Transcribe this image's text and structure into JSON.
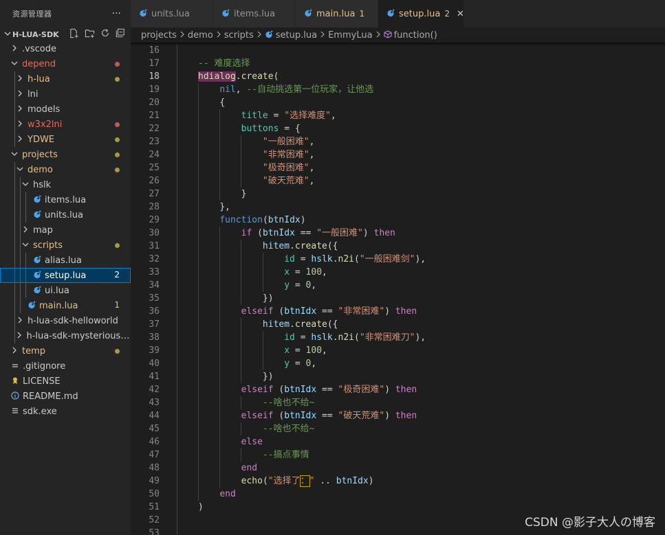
{
  "sidebar": {
    "title": "资源管理器",
    "more": "···",
    "project": "H-LUA-SDK",
    "items": [
      {
        "label": ".vscode",
        "depth": 0,
        "chev": ">",
        "color": "#cccccc"
      },
      {
        "label": "depend",
        "depth": 0,
        "chev": "v",
        "color": "#e06c60",
        "dot": "#c45a55"
      },
      {
        "label": "h-lua",
        "depth": 1,
        "chev": ">",
        "color": "#e2c08d",
        "dot": "#a89a43"
      },
      {
        "label": "lni",
        "depth": 1,
        "chev": ">",
        "color": "#cccccc"
      },
      {
        "label": "models",
        "depth": 1,
        "chev": ">",
        "color": "#cccccc"
      },
      {
        "label": "w3x2lni",
        "depth": 1,
        "chev": ">",
        "color": "#e06c60",
        "dot": "#c45a55"
      },
      {
        "label": "YDWE",
        "depth": 1,
        "chev": ">",
        "color": "#e2c08d",
        "dot": "#a89a43"
      },
      {
        "label": "projects",
        "depth": 0,
        "chev": "v",
        "color": "#e2c08d",
        "dot": "#a89a43"
      },
      {
        "label": "demo",
        "depth": 1,
        "chev": "v",
        "color": "#e2c08d",
        "dot": "#a89a43"
      },
      {
        "label": "hslk",
        "depth": 2,
        "chev": "v",
        "color": "#cccccc"
      },
      {
        "label": "items.lua",
        "depth": 3,
        "chev": "",
        "color": "#cccccc",
        "file": true
      },
      {
        "label": "units.lua",
        "depth": 3,
        "chev": "",
        "color": "#cccccc",
        "file": true
      },
      {
        "label": "map",
        "depth": 2,
        "chev": ">",
        "color": "#cccccc"
      },
      {
        "label": "scripts",
        "depth": 2,
        "chev": "v",
        "color": "#e2c08d",
        "dot": "#a89a43"
      },
      {
        "label": "alias.lua",
        "depth": 3,
        "chev": "",
        "color": "#cccccc",
        "file": true
      },
      {
        "label": "setup.lua",
        "depth": 3,
        "chev": "",
        "color": "#e2c08d",
        "file": true,
        "badge": "2",
        "selected": true
      },
      {
        "label": "ui.lua",
        "depth": 3,
        "chev": "",
        "color": "#cccccc",
        "file": true
      },
      {
        "label": "main.lua",
        "depth": 2,
        "chev": "",
        "color": "#e2c08d",
        "file": true,
        "badge": "1"
      },
      {
        "label": "h-lua-sdk-helloworld",
        "depth": 1,
        "chev": ">",
        "color": "#cccccc"
      },
      {
        "label": "h-lua-sdk-mysterious-la...",
        "depth": 1,
        "chev": ">",
        "color": "#cccccc"
      },
      {
        "label": "temp",
        "depth": 0,
        "chev": ">",
        "color": "#e2c08d",
        "dot": "#a89a43"
      },
      {
        "label": ".gitignore",
        "depth": 0,
        "chev": "",
        "color": "#cccccc",
        "icon": "git"
      },
      {
        "label": "LICENSE",
        "depth": 0,
        "chev": "",
        "color": "#cccccc",
        "icon": "license"
      },
      {
        "label": "README.md",
        "depth": 0,
        "chev": "",
        "color": "#cccccc",
        "icon": "info"
      },
      {
        "label": "sdk.exe",
        "depth": 0,
        "chev": "",
        "color": "#cccccc",
        "icon": "exe"
      }
    ]
  },
  "tabs": [
    {
      "label": "units.lua",
      "active": false
    },
    {
      "label": "items.lua",
      "active": false
    },
    {
      "label": "main.lua",
      "active": false,
      "badge": "1",
      "modified": true
    },
    {
      "label": "setup.lua",
      "active": true,
      "badge": "2",
      "close": "✕"
    }
  ],
  "breadcrumb": [
    "projects",
    "demo",
    "scripts",
    "setup.lua",
    "EmmyLua",
    "function()"
  ],
  "editor": {
    "current_line": 18,
    "lines": [
      {
        "n": 16,
        "html": ""
      },
      {
        "n": 17,
        "html": "<span class=\"c\">-- 难度选择</span>"
      },
      {
        "n": 18,
        "html": "<span class=\"hl\">hdialog</span><span class=\"p\">.</span><span class=\"f\">create</span><span class=\"p\">(</span>"
      },
      {
        "n": 19,
        "html": "    <span class=\"b\">nil</span><span class=\"p\">, </span><span class=\"c\">--自动挑选第一位玩家，让他选</span>"
      },
      {
        "n": 20,
        "html": "    <span class=\"p\">{</span>"
      },
      {
        "n": 21,
        "html": "        <span class=\"g\">title</span><span class=\"p\"> = </span><span class=\"s\">\"选择难度\"</span><span class=\"p\">,</span>"
      },
      {
        "n": 22,
        "html": "        <span class=\"g\">buttons</span><span class=\"p\"> = {</span>"
      },
      {
        "n": 23,
        "html": "            <span class=\"s\">\"一般困难\"</span><span class=\"p\">,</span>"
      },
      {
        "n": 24,
        "html": "            <span class=\"s\">\"非常困难\"</span><span class=\"p\">,</span>"
      },
      {
        "n": 25,
        "html": "            <span class=\"s\">\"极奇困难\"</span><span class=\"p\">,</span>"
      },
      {
        "n": 26,
        "html": "            <span class=\"s\">\"破天荒难\"</span><span class=\"p\">,</span>"
      },
      {
        "n": 27,
        "html": "        <span class=\"p\">}</span>"
      },
      {
        "n": 28,
        "html": "    <span class=\"p\">},</span>"
      },
      {
        "n": 29,
        "html": "    <span class=\"b\">function</span><span class=\"p\">(</span><span class=\"v\">btnIdx</span><span class=\"p\">)</span>"
      },
      {
        "n": 30,
        "html": "        <span class=\"k\">if</span><span class=\"p\"> (</span><span class=\"v\">btnIdx</span><span class=\"p\"> == </span><span class=\"s\">\"一般困难\"</span><span class=\"p\">) </span><span class=\"k\">then</span>"
      },
      {
        "n": 31,
        "html": "            <span class=\"v\">hitem</span><span class=\"p\">.</span><span class=\"f\">create</span><span class=\"p\">({</span>"
      },
      {
        "n": 32,
        "html": "                <span class=\"g\">id</span><span class=\"p\"> = </span><span class=\"v\">hslk</span><span class=\"p\">.</span><span class=\"f\">n2i</span><span class=\"p\">(</span><span class=\"s\">\"一般困难剑\"</span><span class=\"p\">),</span>"
      },
      {
        "n": 33,
        "html": "                <span class=\"g\">x</span><span class=\"p\"> = </span><span class=\"n\">100</span><span class=\"p\">,</span>"
      },
      {
        "n": 34,
        "html": "                <span class=\"g\">y</span><span class=\"p\"> = </span><span class=\"n\">0</span><span class=\"p\">,</span>"
      },
      {
        "n": 35,
        "html": "            <span class=\"p\">})</span>"
      },
      {
        "n": 36,
        "html": "        <span class=\"k\">elseif</span><span class=\"p\"> (</span><span class=\"v\">btnIdx</span><span class=\"p\"> == </span><span class=\"s\">\"非常困难\"</span><span class=\"p\">) </span><span class=\"k\">then</span>"
      },
      {
        "n": 37,
        "html": "            <span class=\"v\">hitem</span><span class=\"p\">.</span><span class=\"f\">create</span><span class=\"p\">({</span>"
      },
      {
        "n": 38,
        "html": "                <span class=\"g\">id</span><span class=\"p\"> = </span><span class=\"v\">hslk</span><span class=\"p\">.</span><span class=\"f\">n2i</span><span class=\"p\">(</span><span class=\"s\">\"非常困难刀\"</span><span class=\"p\">),</span>"
      },
      {
        "n": 39,
        "html": "                <span class=\"g\">x</span><span class=\"p\"> = </span><span class=\"n\">100</span><span class=\"p\">,</span>"
      },
      {
        "n": 40,
        "html": "                <span class=\"g\">y</span><span class=\"p\"> = </span><span class=\"n\">0</span><span class=\"p\">,</span>"
      },
      {
        "n": 41,
        "html": "            <span class=\"p\">})</span>"
      },
      {
        "n": 42,
        "html": "        <span class=\"k\">elseif</span><span class=\"p\"> (</span><span class=\"v\">btnIdx</span><span class=\"p\"> == </span><span class=\"s\">\"极奇困难\"</span><span class=\"p\">) </span><span class=\"k\">then</span>"
      },
      {
        "n": 43,
        "html": "            <span class=\"c\">--啥也不给~</span>"
      },
      {
        "n": 44,
        "html": "        <span class=\"k\">elseif</span><span class=\"p\"> (</span><span class=\"v\">btnIdx</span><span class=\"p\"> == </span><span class=\"s\">\"破天荒难\"</span><span class=\"p\">) </span><span class=\"k\">then</span>"
      },
      {
        "n": 45,
        "html": "            <span class=\"c\">--啥也不给~</span>"
      },
      {
        "n": 46,
        "html": "        <span class=\"k\">else</span>"
      },
      {
        "n": 47,
        "html": "            <span class=\"c\">--搞点事情</span>"
      },
      {
        "n": 48,
        "html": "        <span class=\"k\">end</span>"
      },
      {
        "n": 49,
        "html": "        <span class=\"f\">echo</span><span class=\"p\">(</span><span class=\"s\">\"选择了<span class=\"boxch\">：</span>\"</span><span class=\"p\"> .. </span><span class=\"v\">btnIdx</span><span class=\"p\">)</span>"
      },
      {
        "n": 50,
        "html": "    <span class=\"k\">end</span>"
      },
      {
        "n": 51,
        "html": "<span class=\"p\">)</span>"
      },
      {
        "n": 52,
        "html": ""
      },
      {
        "n": 53,
        "html": ""
      }
    ]
  },
  "watermark": "CSDN @影子大人の博客"
}
